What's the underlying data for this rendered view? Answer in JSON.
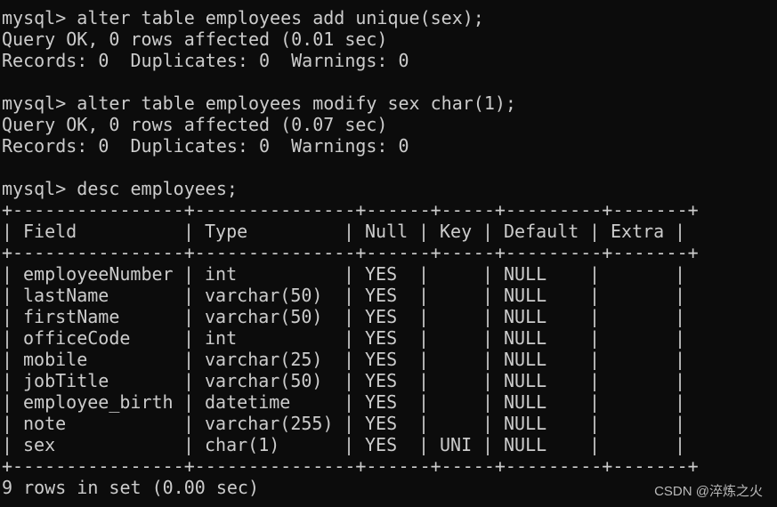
{
  "terminal": {
    "lines_block1": [
      "mysql> alter table employees add unique(sex);",
      "Query OK, 0 rows affected (0.01 sec)",
      "Records: 0  Duplicates: 0  Warnings: 0"
    ],
    "lines_block2": [
      "mysql> alter table employees modify sex char(1);",
      "Query OK, 0 rows affected (0.07 sec)",
      "Records: 0  Duplicates: 0  Warnings: 0"
    ],
    "desc_command": "mysql> desc employees;",
    "table_border_top": "+----------------+---------------+------+-----+---------+-------+",
    "table_border_mid": "+----------------+---------------+------+-----+---------+-------+",
    "table_border_bottom": "+----------------+---------------+------+-----+---------+-------+",
    "headers": [
      "Field",
      "Type",
      "Null",
      "Key",
      "Default",
      "Extra"
    ],
    "rows": [
      [
        "employeeNumber",
        "int",
        "YES",
        "",
        "NULL",
        ""
      ],
      [
        "lastName",
        "varchar(50)",
        "YES",
        "",
        "NULL",
        ""
      ],
      [
        "firstName",
        "varchar(50)",
        "YES",
        "",
        "NULL",
        ""
      ],
      [
        "officeCode",
        "int",
        "YES",
        "",
        "NULL",
        ""
      ],
      [
        "mobile",
        "varchar(25)",
        "YES",
        "",
        "NULL",
        ""
      ],
      [
        "jobTitle",
        "varchar(50)",
        "YES",
        "",
        "NULL",
        ""
      ],
      [
        "employee_birth",
        "datetime",
        "YES",
        "",
        "NULL",
        ""
      ],
      [
        "note",
        "varchar(255)",
        "YES",
        "",
        "NULL",
        ""
      ],
      [
        "sex",
        "char(1)",
        "YES",
        "UNI",
        "NULL",
        ""
      ]
    ],
    "result_summary": "9 rows in set (0.00 sec)"
  },
  "watermark": "CSDN @淬炼之火",
  "colors": {
    "background": "#0c0c0c",
    "text": "#cccccc"
  }
}
